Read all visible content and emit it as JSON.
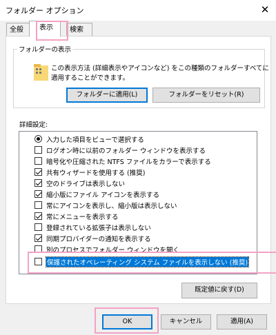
{
  "window": {
    "title": "フォルダー オプション"
  },
  "tabs": [
    {
      "label": "全般"
    },
    {
      "label": "表示"
    },
    {
      "label": "検索"
    }
  ],
  "folder_view": {
    "group_label": "フォルダーの表示",
    "desc_line1": "この表示方法 (詳細表示やアイコンなど) をこの種類のフォルダーすべてに",
    "desc_line2": "適用することができます。",
    "apply_button": "フォルダーに適用(L)",
    "reset_button": "フォルダーをリセット(R)"
  },
  "advanced": {
    "label": "詳細設定:",
    "items": [
      {
        "label": "入力した項目をビューで選択する",
        "type": "radio",
        "checked": true
      },
      {
        "label": "ログオン時に以前のフォルダー ウィンドウを表示する",
        "type": "checkbox",
        "checked": false
      },
      {
        "label": "暗号化や圧縮された NTFS ファイルをカラーで表示する",
        "type": "checkbox",
        "checked": false
      },
      {
        "label": "共有ウィザードを使用する (推奨)",
        "type": "checkbox",
        "checked": true
      },
      {
        "label": "空のドライブは表示しない",
        "type": "checkbox",
        "checked": true
      },
      {
        "label": "縮小版にファイル アイコンを表示する",
        "type": "checkbox",
        "checked": true
      },
      {
        "label": "常にアイコンを表示し、縮小版は表示しない",
        "type": "checkbox",
        "checked": false
      },
      {
        "label": "常にメニューを表示する",
        "type": "checkbox",
        "checked": true
      },
      {
        "label": "登録されている拡張子は表示しない",
        "type": "checkbox",
        "checked": false
      },
      {
        "label": "同期プロバイダーの通知を表示する",
        "type": "checkbox",
        "checked": true
      },
      {
        "label": "別のプロセスでフォルダー ウィンドウを開く",
        "type": "checkbox",
        "checked": false
      },
      {
        "label": "保護されたオペレーティング システム ファイルを表示しない (推奨)",
        "type": "checkbox",
        "checked": false,
        "selected": true
      }
    ],
    "restore_button": "既定値に戻す(D)"
  },
  "footer": {
    "ok": "OK",
    "cancel": "キャンセル",
    "apply": "適用(A)"
  },
  "colors": {
    "highlight": "#f2a2c4",
    "selection": "#0078d7",
    "focus_border": "#0078d7"
  }
}
